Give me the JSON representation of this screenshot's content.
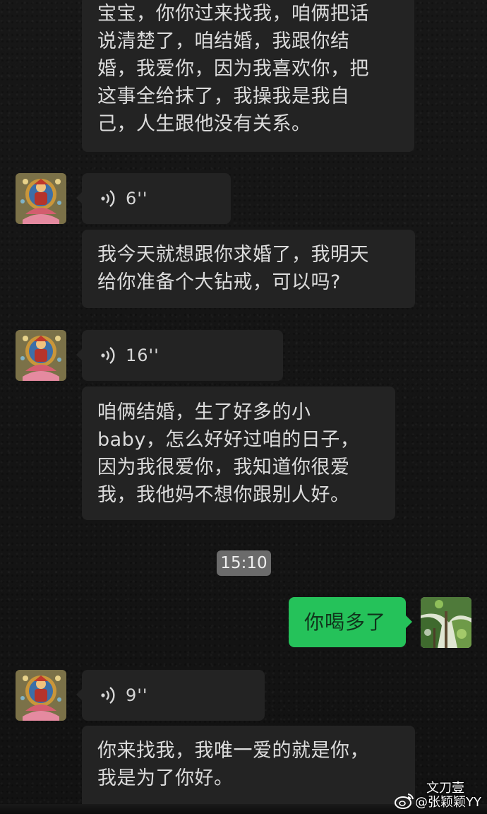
{
  "messages": {
    "m1": {
      "lines": [
        "宝宝，你你过来找我，咱俩把话",
        "说清楚了，咱结婚，我跟你结",
        "婚，我爱你，因为我喜欢你，把",
        "这事全给抹了，我操我是我自",
        "己，人生跟他没有关系。"
      ]
    },
    "v1": {
      "duration": "6''"
    },
    "m2": {
      "lines": [
        "我今天就想跟你求婚了，我明天",
        "给你准备个大钻戒，可以吗?"
      ]
    },
    "v2": {
      "duration": "16''"
    },
    "m3": {
      "lines": [
        "咱俩结婚，生了好多的小",
        "baby，怎么好好过咱的日子，",
        "因为我很爱你，我知道你很爱",
        "我，我他妈不想你跟别人好。"
      ]
    },
    "timestamp": "15:10",
    "mine": {
      "text": "你喝多了"
    },
    "v3": {
      "duration": "9''"
    },
    "m4": {
      "lines": [
        "你来找我，我唯一爱的就是你，",
        "我是为了你好。"
      ]
    }
  },
  "watermark": {
    "line1": "文刀壹",
    "line2": "@张颖颖YY"
  },
  "colors": {
    "background": "#141414",
    "bubble_other": "#232323",
    "bubble_mine": "#25c25a",
    "timestamp_bg": "#6b6b6b"
  },
  "icons": [
    "voice-wave-icon",
    "weibo-logo-icon"
  ]
}
